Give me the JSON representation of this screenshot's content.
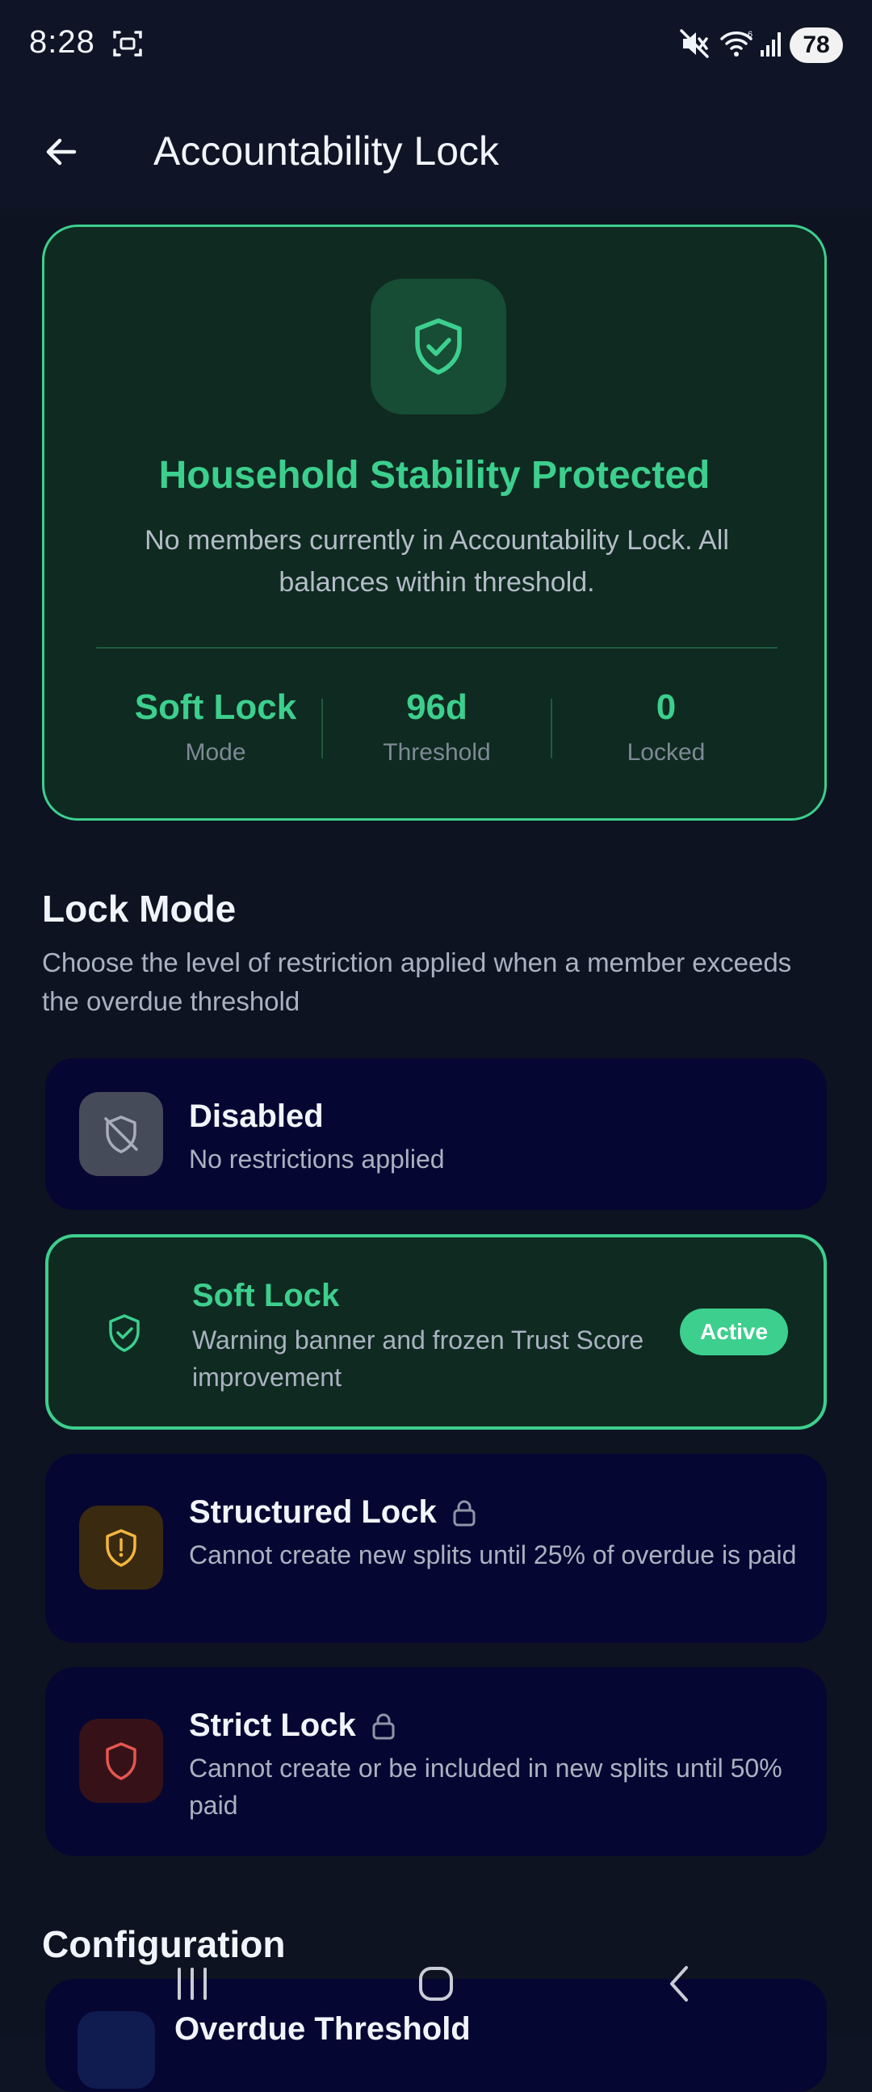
{
  "status_bar": {
    "time": "8:28",
    "battery": "78"
  },
  "app_bar": {
    "title": "Accountability Lock"
  },
  "hero": {
    "title": "Household Stability Protected",
    "subtitle": "No members currently in Accountability Lock. All balances within threshold.",
    "stats": [
      {
        "value": "Soft Lock",
        "label": "Mode"
      },
      {
        "value": "96d",
        "label": "Threshold"
      },
      {
        "value": "0",
        "label": "Locked"
      }
    ]
  },
  "lock_mode": {
    "title": "Lock Mode",
    "description": "Choose the level of restriction applied when a member exceeds the overdue threshold",
    "options": [
      {
        "title": "Disabled",
        "desc": "No restrictions applied",
        "icon": "shield-off-icon",
        "locked": false,
        "active": false
      },
      {
        "title": "Soft Lock",
        "desc": "Warning banner and frozen Trust Score improvement",
        "icon": "shield-check-icon",
        "locked": false,
        "active": true,
        "badge": "Active"
      },
      {
        "title": "Structured Lock",
        "desc": "Cannot create new splits until 25% of overdue is paid",
        "icon": "shield-alert-icon",
        "locked": true,
        "active": false
      },
      {
        "title": "Strict Lock",
        "desc": "Cannot create or be included in new splits until 50% paid",
        "icon": "shield-icon",
        "locked": true,
        "active": false
      }
    ]
  },
  "configuration": {
    "title": "Configuration",
    "first_item": "Overdue Threshold"
  },
  "colors": {
    "accent": "#3ccf8e",
    "card": "#060632",
    "background": "#0e1322",
    "warning": "#f3b63f",
    "danger": "#e5574f"
  }
}
